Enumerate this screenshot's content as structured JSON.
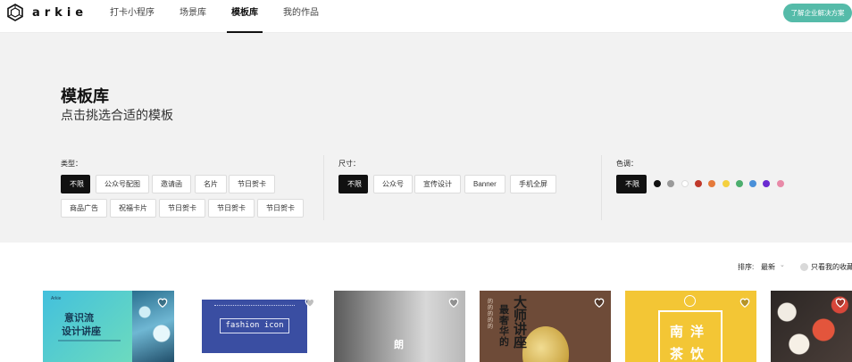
{
  "header": {
    "logo_text": "arkie",
    "nav": [
      {
        "label": "打卡小程序",
        "active": false
      },
      {
        "label": "场景库",
        "active": false
      },
      {
        "label": "模板库",
        "active": true
      },
      {
        "label": "我的作品",
        "active": false
      }
    ],
    "cta_label": "了解企业解决方案"
  },
  "hero": {
    "title": "模板库",
    "subtitle": "点击挑选合适的模板"
  },
  "filters": {
    "type": {
      "label": "类型：",
      "row1": [
        "不限",
        "公众号配图",
        "邀请函",
        "名片",
        "节日贺卡"
      ],
      "row2": [
        "商品广告",
        "祝福卡片",
        "节日贺卡",
        "节日贺卡",
        "节日贺卡"
      ],
      "selected": "不限"
    },
    "size": {
      "label": "尺寸：",
      "options": [
        "不限",
        "公众号",
        "宣传设计",
        "Banner",
        "手机全屏"
      ],
      "selected": "不限"
    },
    "color": {
      "label": "色调：",
      "all_label": "不限",
      "swatches": [
        "#111111",
        "#9a9a9a",
        "#ffffff",
        "#c0392b",
        "#e57a3b",
        "#f4d03f",
        "#4cae6e",
        "#4a90d9",
        "#6a2bd1",
        "#e88aa8"
      ]
    }
  },
  "sort": {
    "label": "排序:",
    "value": "最新",
    "favorites_label": "只看我的收藏"
  },
  "cards": [
    {
      "title_line1": "意识流",
      "title_line2": "设计讲座",
      "brand": "Arkie"
    },
    {
      "label": "fashion icon"
    },
    {
      "char": "朗"
    },
    {
      "big": "大师讲座",
      "small": "最奢华的"
    },
    {
      "line1": "南洋",
      "line2": "茶饮"
    },
    {}
  ],
  "colors": {
    "accent": "#55bba9",
    "selected_chip": "#111111",
    "hero_bg": "#f2f2f2"
  }
}
